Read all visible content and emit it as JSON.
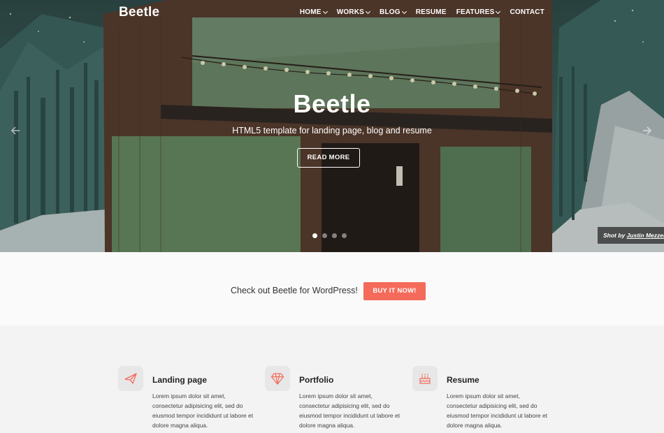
{
  "brand": {
    "logo": "Beetle",
    "accent": "#f46b5b"
  },
  "nav": {
    "items": [
      {
        "label": "HOME",
        "dropdown": true
      },
      {
        "label": "WORKS",
        "dropdown": true
      },
      {
        "label": "BLOG",
        "dropdown": true
      },
      {
        "label": "RESUME",
        "dropdown": false
      },
      {
        "label": "FEATURES",
        "dropdown": true
      },
      {
        "label": "CONTACT",
        "dropdown": false
      }
    ]
  },
  "hero": {
    "title": "Beetle",
    "subtitle": "HTML5 template for landing page, blog and resume",
    "button_label": "READ MORE",
    "slides_total": 4,
    "slide_active": 1,
    "credit_prefix": "Shot by",
    "credit_name": "Justin Mezzell"
  },
  "cta": {
    "text": "Check out Beetle for WordPress!",
    "button_label": "BUY IT NOW!"
  },
  "features": [
    {
      "icon": "paper-plane-icon",
      "title": "Landing page",
      "text": "Lorem ipsum dolor sit amet, consectetur adipisicing elit, sed do eiusmod tempor incididunt ut labore et dolore magna aliqua."
    },
    {
      "icon": "diamond-icon",
      "title": "Portfolio",
      "text": "Lorem ipsum dolor sit amet, consectetur adipisicing elit, sed do eiusmod tempor incididunt ut labore et dolore magna aliqua."
    },
    {
      "icon": "cake-icon",
      "title": "Resume",
      "text": "Lorem ipsum dolor sit amet, consectetur adipisicing elit, sed do eiusmod tempor incididunt ut labore et dolore magna aliqua."
    }
  ]
}
